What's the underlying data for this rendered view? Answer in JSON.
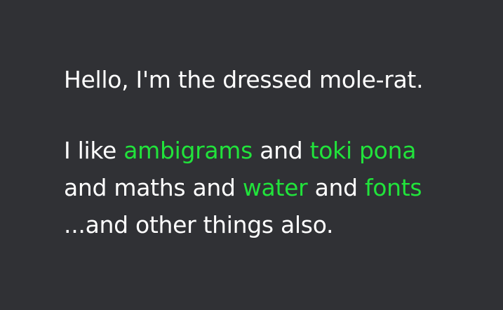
{
  "colors": {
    "background": "#303135",
    "text": "#ffffff",
    "link": "#21e33b"
  },
  "greeting": "Hello, I'm the dressed mole-rat.",
  "about": {
    "line1": {
      "lead": "I like ",
      "link1": "ambigrams",
      "joiner": " and ",
      "link2": "toki pona"
    },
    "line2": {
      "lead": "and maths and ",
      "link1": "water",
      "joiner": " and ",
      "link2": "fonts"
    },
    "line3": "...and other things also."
  }
}
